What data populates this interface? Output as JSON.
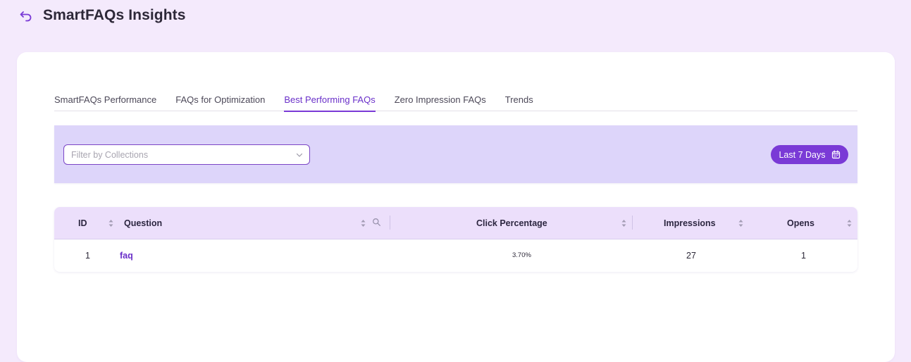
{
  "header": {
    "title": "SmartFAQs Insights",
    "back_icon": "back-arrow-icon"
  },
  "tabs": [
    {
      "label": "SmartFAQs Performance",
      "active": false
    },
    {
      "label": "FAQs for Optimization",
      "active": false
    },
    {
      "label": "Best Performing FAQs",
      "active": true
    },
    {
      "label": "Zero Impression FAQs",
      "active": false
    },
    {
      "label": "Trends",
      "active": false
    }
  ],
  "filters": {
    "collections_placeholder": "Filter by Collections",
    "date_range_label": "Last 7 Days",
    "date_icon": "calendar-icon"
  },
  "table": {
    "columns": {
      "id": "ID",
      "question": "Question",
      "click_percentage": "Click Percentage",
      "impressions": "Impressions",
      "opens": "Opens"
    },
    "rows": [
      {
        "id": "1",
        "question": "faq",
        "click_percentage": "3.70%",
        "impressions": "27",
        "opens": "1"
      }
    ]
  },
  "colors": {
    "accent": "#7a3ad6",
    "page_bg": "#f4eafc",
    "filter_bar_bg": "#ddd5fa",
    "table_header_bg": "#ecdffb"
  }
}
